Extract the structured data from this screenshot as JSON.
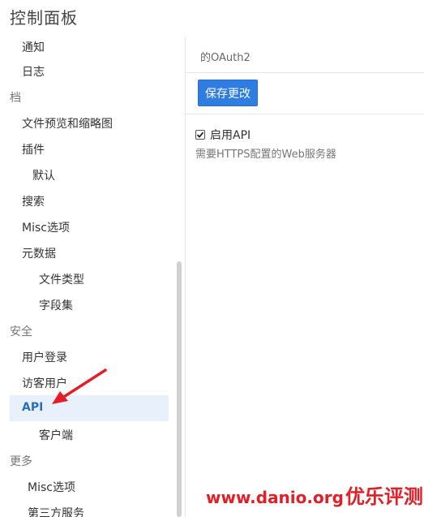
{
  "title": "控制面板",
  "sidebar": {
    "items": [
      {
        "label": "通知",
        "type": "item",
        "indent": 1
      },
      {
        "label": "日志",
        "type": "item",
        "indent": 1
      },
      {
        "label": "档",
        "type": "section",
        "indent": 0
      },
      {
        "label": "文件预览和缩略图",
        "type": "item",
        "indent": 1
      },
      {
        "label": "插件",
        "type": "item",
        "indent": 1
      },
      {
        "label": "默认",
        "type": "item",
        "indent": 2
      },
      {
        "label": "搜索",
        "type": "item",
        "indent": 1
      },
      {
        "label": "Misc选项",
        "type": "item",
        "indent": 1
      },
      {
        "label": "元数据",
        "type": "item",
        "indent": 1
      },
      {
        "label": "文件类型",
        "type": "item",
        "indent": 3
      },
      {
        "label": "字段集",
        "type": "item",
        "indent": 3
      },
      {
        "label": "安全",
        "type": "section",
        "indent": 0
      },
      {
        "label": "用户登录",
        "type": "item",
        "indent": 1
      },
      {
        "label": "访客用户",
        "type": "item",
        "indent": 1
      },
      {
        "label": "API",
        "type": "item",
        "indent": 1,
        "active": true
      },
      {
        "label": "客户端",
        "type": "item",
        "indent": 3
      },
      {
        "label": "更多",
        "type": "section",
        "indent": 0
      },
      {
        "label": "Misc选项",
        "type": "item",
        "indent": 2
      },
      {
        "label": "第三方服务",
        "type": "item",
        "indent": 2
      }
    ]
  },
  "content": {
    "header": "的OAuth2",
    "save_label": "保存更改",
    "checkbox_label": "启用API",
    "checkbox_checked": true,
    "help_text": "需要HTTPS配置的Web服务器"
  },
  "watermark": {
    "url": "www.danio",
    "suffix": ".org",
    "zh": "优乐评测网"
  },
  "colors": {
    "accent": "#2f7de1",
    "active_bg": "#e8f1fb",
    "active_text": "#2a6ebb",
    "arrow": "#e41e26"
  }
}
